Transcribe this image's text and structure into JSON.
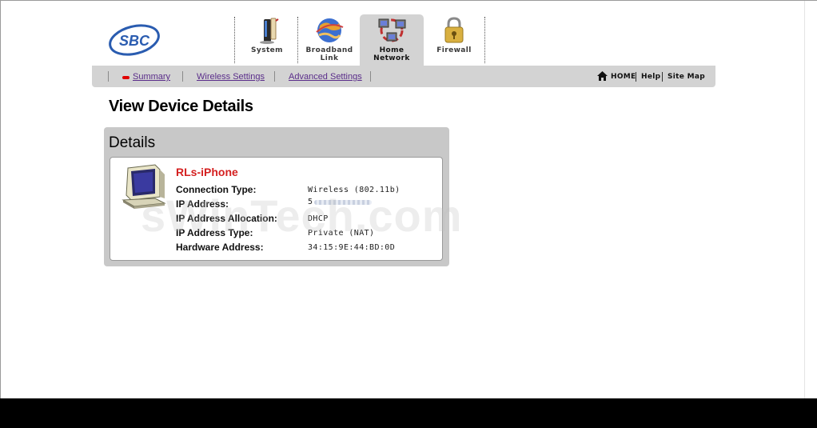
{
  "brand": {
    "logo_text": "SBC"
  },
  "tabs": [
    {
      "label": "System",
      "icon": "modem-icon"
    },
    {
      "label": "Broadband Link",
      "line1": "Broadband",
      "line2": "Link",
      "icon": "globe-icon"
    },
    {
      "label": "Home Network",
      "line1": "Home",
      "line2": "Network",
      "icon": "network-icon",
      "active": true
    },
    {
      "label": "Firewall",
      "icon": "padlock-icon"
    }
  ],
  "subnav": {
    "links": [
      "Summary",
      "Wireless Settings",
      "Advanced Settings"
    ],
    "right": [
      "HOME",
      "Help",
      "Site Map"
    ]
  },
  "page": {
    "title": "View Device Details"
  },
  "panel": {
    "title": "Details",
    "device": {
      "name": "RLs-iPhone",
      "fields": [
        {
          "label": "Connection Type:",
          "value": "Wireless (802.11b)"
        },
        {
          "label": "IP Address:",
          "value": "5"
        },
        {
          "label": "IP Address Allocation:",
          "value": "DHCP"
        },
        {
          "label": "IP Address Type:",
          "value": "Private (NAT)"
        },
        {
          "label": "Hardware Address:",
          "value": "34:15:9E:44:BD:0D"
        }
      ]
    }
  },
  "watermark": "sWinTech.com",
  "colors": {
    "tab_active_bg": "#d3d3d3",
    "link": "#5a2d8a",
    "device_name": "#d42020",
    "panel_bg": "#c8c8c8"
  }
}
